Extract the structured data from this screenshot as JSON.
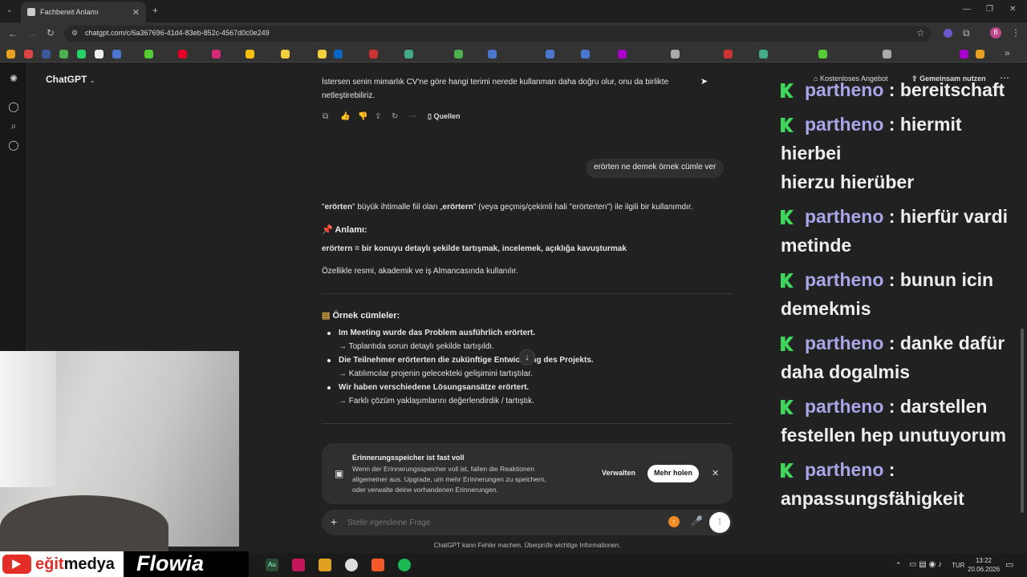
{
  "browser": {
    "tab_title": "Fachbereit Anlamı",
    "new_tab_icon": "+",
    "url": "chatgpt.com/c/6a367696-41d4-83eb-852c-4567d0c0e249",
    "window_controls": [
      "—",
      "❐",
      "✕"
    ],
    "profile_initial": "B"
  },
  "app": {
    "model_name": "ChatGPT",
    "header_links": {
      "free_offer": "Kostenloses Angebot",
      "share": "Gemeinsam nutzen"
    }
  },
  "chat": {
    "prev_answer_line1": "İstersen senin mimarlık CV'ne göre hangi terimi nerede kullanman daha doğru olur, onu da birlikte",
    "prev_answer_line2": "netleştirebiliriz.",
    "sources_label": "Quellen",
    "user_message": "erörten ne demek örnek cümle ver",
    "answer_intro_q": "\"",
    "answer_intro_word": "erörten",
    "answer_intro_mid": "\" büyük ihtimalle fiil olan „",
    "answer_intro_word2": "erörtern",
    "answer_intro_end": "\" (veya geçmiş/çekimli hali \"erörterten\") ile ilgili bir kullanımdır.",
    "meaning_heading": "Anlamı:",
    "meaning_line": "erörtern = bir konuyu detaylı şekilde tartışmak, incelemek, açıklığa kavuşturmak",
    "usage_note": "Özellikle resmi, akademik ve iş Almancasında kullanılır.",
    "examples_heading": "Örnek cümleler:",
    "examples": [
      {
        "de": "Im Meeting wurde das Problem ausführlich erörtert.",
        "tr": "→ Toplantıda sorun detaylı şekilde tartışıldı."
      },
      {
        "de": "Die Teilnehmer erörterten die zukünftige Entwicklung des Projekts.",
        "tr": "→ Katılımcılar projenin gelecekteki gelişimini tartıştılar."
      },
      {
        "de": "Wir haben verschiedene Lösungsansätze erörtert.",
        "tr": "→ Farklı çözüm yaklaşımlarını değerlendirdik / tartıştık."
      }
    ]
  },
  "memory_notice": {
    "title": "Erinnerungsspeicher ist fast voll",
    "body_line1": "Wenn der Erinnerungsspeicher voll ist, fallen die Reaktionen",
    "body_line2": "allgemeiner aus. Upgrade, um mehr Erinnerungen zu speichern,",
    "body_line3": "oder verwalte deine vorhandenen Erinnerungen.",
    "manage_label": "Verwalten",
    "upgrade_label": "Mehr holen"
  },
  "composer": {
    "placeholder": "Stelle irgendeine Frage",
    "footer": "ChatGPT kann Fehler machen. Überprüfe wichtige Informationen."
  },
  "stream_chat": [
    {
      "user": "partheno",
      "text": " : bereitschaft",
      "cont": ""
    },
    {
      "user": "partheno",
      "text": " : hiermit hierbei",
      "cont": "hierzu hierüber"
    },
    {
      "user": "partheno",
      "text": " : hierfür vardi",
      "cont": "metinde"
    },
    {
      "user": "partheno",
      "text": " : bunun icin",
      "cont": "demekmis"
    },
    {
      "user": "partheno",
      "text": " : danke dafür",
      "cont": "daha dogalmis"
    },
    {
      "user": "partheno",
      "text": " : darstellen",
      "cont": "festellen hep unutuyorum"
    },
    {
      "user": "partheno",
      "text": " :",
      "cont": "anpassungsfähigkeit"
    }
  ],
  "banner": {
    "brand1_pre": "eğit",
    "brand1_post": "medya",
    "brand2": "Flowia"
  },
  "taskbar": {
    "lang": "TUR",
    "time": "13:22",
    "date": "20.06.2026"
  },
  "colors": {
    "accent_badge": "#3fd45a",
    "username": "#a9a6e8",
    "upgrade_icon": "#f08a24"
  }
}
